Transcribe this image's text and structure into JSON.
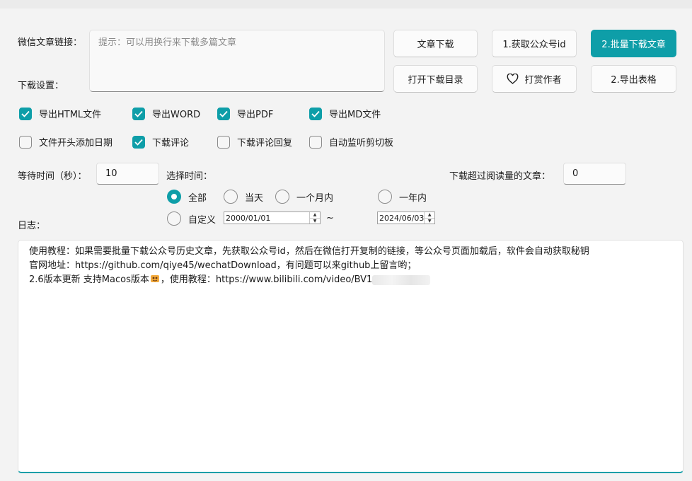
{
  "labels": {
    "url": "微信文章链接：",
    "download_settings": "下载设置：",
    "wait_time": "等待时间（秒）：",
    "select_time": "选择时间：",
    "min_reads": "下载超过阅读量的文章：",
    "log": "日志："
  },
  "url_input": {
    "placeholder": "提示：可以用换行来下载多篇文章",
    "value": ""
  },
  "buttons": {
    "article_download": "文章下载",
    "get_account_id": "1.获取公众号id",
    "batch_download": "2.批量下载文章",
    "open_dir": "打开下载目录",
    "tip_author": "打赏作者",
    "export_table": "2.导出表格"
  },
  "checkboxes": [
    {
      "label": "导出HTML文件",
      "checked": true
    },
    {
      "label": "导出WORD",
      "checked": true
    },
    {
      "label": "导出PDF",
      "checked": true
    },
    {
      "label": "导出MD文件",
      "checked": true
    },
    {
      "label": "文件开头添加日期",
      "checked": false
    },
    {
      "label": "下载评论",
      "checked": true
    },
    {
      "label": "下载评论回复",
      "checked": false
    },
    {
      "label": "自动监听剪切板",
      "checked": false
    }
  ],
  "wait_time_value": "10",
  "min_reads_value": "0",
  "radios": [
    {
      "label": "全部",
      "selected": true
    },
    {
      "label": "当天",
      "selected": false
    },
    {
      "label": "一个月内",
      "selected": false
    },
    {
      "label": "一年内",
      "selected": false
    },
    {
      "label": "自定义",
      "selected": false
    }
  ],
  "date_from": "2000/01/01",
  "date_to": "2024/06/03",
  "date_sep": "~",
  "log_lines": [
    "使用教程：如果需要批量下载公众号历史文章，先获取公众号id，然后在微信打开复制的链接，等公众号页面加载后，软件会自动获取秘钥",
    "官网地址：https://github.com/qiye45/wechatDownload，有问题可以来github上留言哟；",
    "2.6版本更新 支持Macos版本",
    "，使用教程：https://www.bilibili.com/video/BV1"
  ],
  "colors": {
    "accent": "#0e9ea8",
    "background": "#f3f3f3"
  }
}
